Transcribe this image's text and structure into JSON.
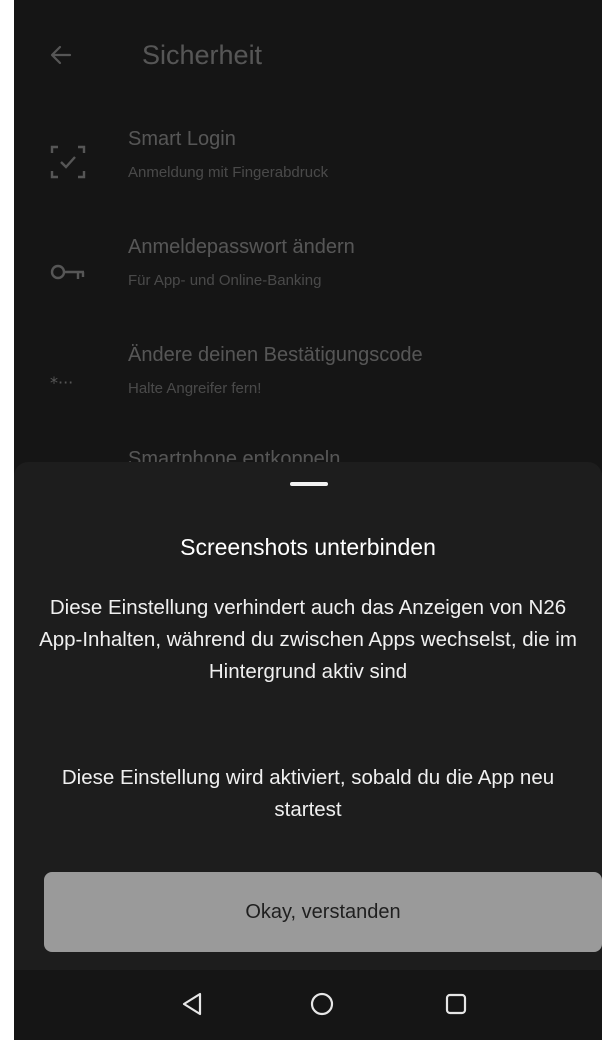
{
  "header": {
    "title": "Sicherheit",
    "back_icon": "arrow-left-icon"
  },
  "settings": {
    "items": [
      {
        "title": "Smart Login",
        "subtitle": "Anmeldung mit Fingerabdruck",
        "icon": "fingerprint-scan-icon"
      },
      {
        "title": "Anmeldepasswort ändern",
        "subtitle": "Für App- und Online-Banking",
        "icon": "key-icon"
      },
      {
        "title": "Ändere deinen Bestätigungscode",
        "subtitle": "Halte Angreifer fern!",
        "icon": "passcode-icon"
      },
      {
        "title": "Smartphone entkoppeln",
        "subtitle": "",
        "icon": "unlink-icon"
      }
    ]
  },
  "sheet": {
    "title": "Screenshots unterbinden",
    "paragraph1": "Diese Einstellung verhindert auch das Anzeigen von N26 App-Inhalten, während du zwischen Apps wechselst, die im Hintergrund aktiv sind",
    "paragraph2": "Diese Einstellung wird aktiviert, sobald du die App neu startest",
    "button_label": "Okay, verstanden"
  },
  "system_nav": {
    "back_icon": "triangle-back-icon",
    "home_icon": "circle-home-icon",
    "recents_icon": "square-recents-icon"
  },
  "colors": {
    "background": "#151515",
    "sheet": "#1d1d1d",
    "button": "#9a9a9a"
  }
}
